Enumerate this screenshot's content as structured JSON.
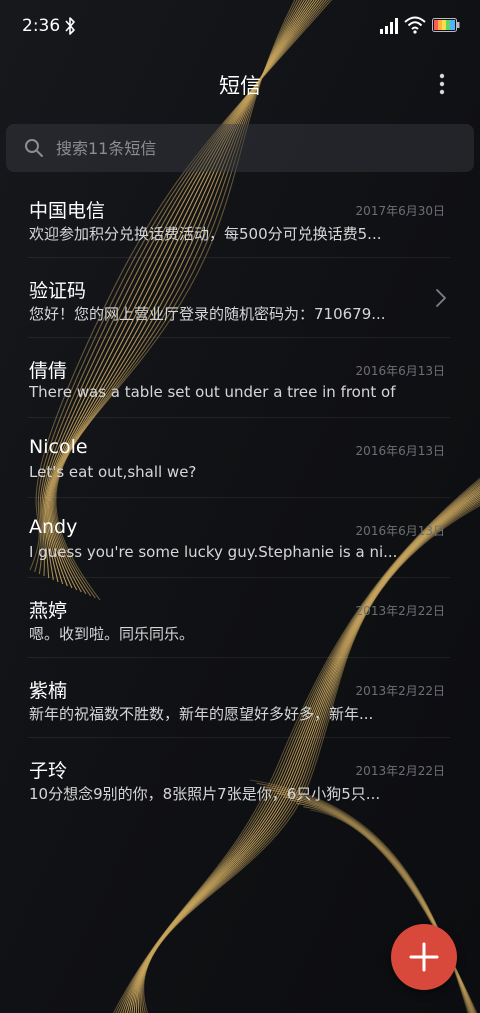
{
  "status_bar": {
    "time": "2:36",
    "icons": [
      "bluetooth-icon",
      "signal-icon",
      "wifi-icon",
      "battery-icon"
    ]
  },
  "header": {
    "title": "短信",
    "more_icon": "more-vertical-icon"
  },
  "search": {
    "placeholder": "搜索11条短信",
    "value": "",
    "icon": "search-icon"
  },
  "messages": [
    {
      "sender": "中国电信",
      "preview": "欢迎参加积分兑换话费活动，每500分可兑换话费5...",
      "date": "2017年6月30日"
    },
    {
      "sender": "验证码",
      "preview": "您好！您的网上营业厅登录的随机密码为：710679...",
      "date": "",
      "icon": "chevron-right-icon"
    },
    {
      "sender": "倩倩",
      "preview": "There was a table set out under a tree in front of ...",
      "date": "2016年6月13日"
    },
    {
      "sender": "Nicole",
      "preview": "Let's eat out,shall we?",
      "date": "2016年6月13日"
    },
    {
      "sender": "Andy",
      "preview": "I guess you're some lucky guy.Stephanie is a ni...",
      "date": "2016年6月13日"
    },
    {
      "sender": "燕婷",
      "preview": "嗯。收到啦。同乐同乐。",
      "date": "2013年2月22日"
    },
    {
      "sender": "紫楠",
      "preview": "新年的祝福数不胜数，新年的愿望好多好多，新年...",
      "date": "2013年2月22日"
    },
    {
      "sender": "子玲",
      "preview": "10分想念9别的你，8张照片7张是你，6只小狗5只...",
      "date": "2013年2月22日"
    }
  ],
  "fab": {
    "icon": "plus-icon"
  },
  "colors": {
    "background": "#121316",
    "accent": "#d8493c",
    "wave": "#c8a55e",
    "secondary_text": "#6c6f75"
  }
}
